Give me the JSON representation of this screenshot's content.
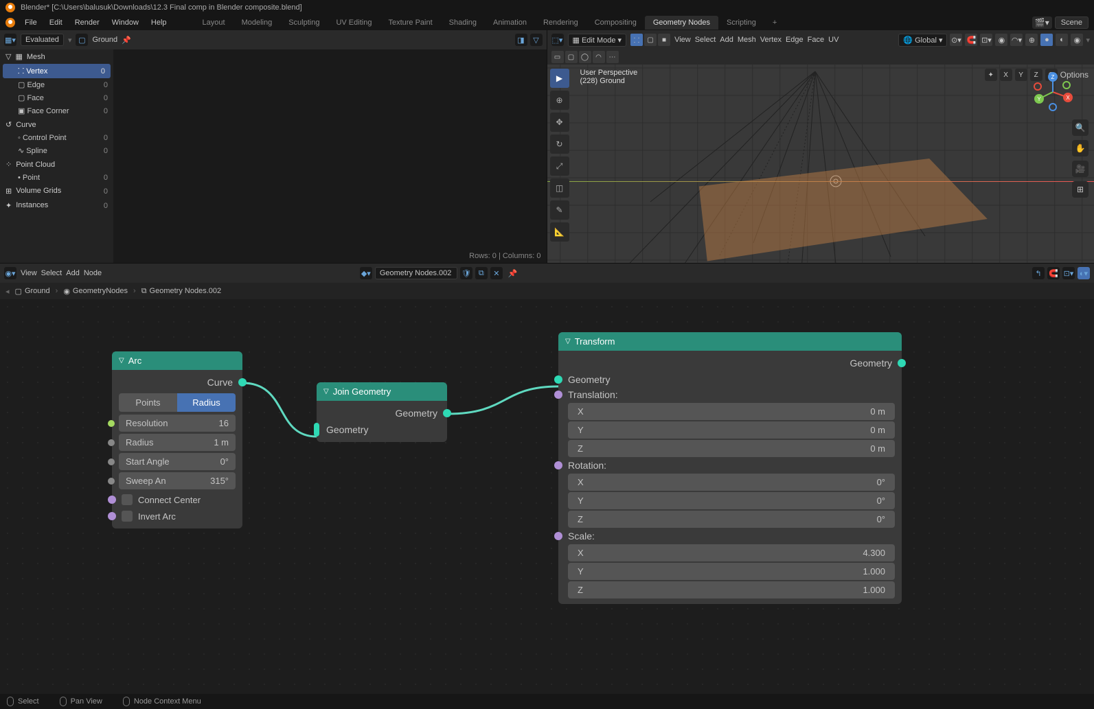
{
  "titlebar": {
    "text": "Blender* [C:\\Users\\balusuk\\Downloads\\12.3 Final comp in Blender composite.blend]"
  },
  "topmenu": {
    "items": [
      "File",
      "Edit",
      "Render",
      "Window",
      "Help"
    ]
  },
  "workspaces": {
    "tabs": [
      "Layout",
      "Modeling",
      "Sculpting",
      "UV Editing",
      "Texture Paint",
      "Shading",
      "Animation",
      "Rendering",
      "Compositing",
      "Geometry Nodes",
      "Scripting"
    ],
    "active": "Geometry Nodes",
    "add": "+"
  },
  "scene": {
    "label": "Scene"
  },
  "spreadsheet": {
    "eval": "Evaluated",
    "object": "Ground",
    "domains": {
      "mesh_label": "Mesh",
      "items_mesh": [
        {
          "label": "Vertex",
          "count": "0",
          "active": true
        },
        {
          "label": "Edge",
          "count": "0"
        },
        {
          "label": "Face",
          "count": "0"
        },
        {
          "label": "Face Corner",
          "count": "0"
        }
      ],
      "curve_label": "Curve",
      "items_curve": [
        {
          "label": "Control Point",
          "count": "0"
        },
        {
          "label": "Spline",
          "count": "0"
        }
      ],
      "pc_label": "Point Cloud",
      "items_pc": [
        {
          "label": "Point",
          "count": "0"
        }
      ],
      "vg_label": "Volume Grids",
      "vg_count": "0",
      "inst_label": "Instances",
      "inst_count": "0"
    },
    "footer": "Rows: 0   |   Columns: 0"
  },
  "viewport": {
    "mode": "Edit Mode",
    "menus": [
      "View",
      "Select",
      "Add",
      "Mesh",
      "Vertex",
      "Edge",
      "Face",
      "UV"
    ],
    "orientation": "Global",
    "options": "Options",
    "info_line1": "User Perspective",
    "info_line2": "(228) Ground",
    "axes": [
      "X",
      "Y",
      "Z"
    ]
  },
  "nodeeditor": {
    "menus": [
      "View",
      "Select",
      "Add",
      "Node"
    ],
    "ng_name": "Geometry Nodes.002",
    "breadcrumb": [
      "Ground",
      "GeometryNodes",
      "Geometry Nodes.002"
    ],
    "nodes": {
      "arc": {
        "title": "Arc",
        "out": "Curve",
        "mode_opts": [
          "Points",
          "Radius"
        ],
        "mode_active": "Radius",
        "fields": [
          {
            "label": "Resolution",
            "value": "16",
            "sock": "lime"
          },
          {
            "label": "Radius",
            "value": "1 m",
            "sock": "gray"
          },
          {
            "label": "Start Angle",
            "value": "0°",
            "sock": "gray"
          },
          {
            "label": "Sweep An",
            "value": "315°",
            "sock": "gray"
          }
        ],
        "checks": [
          {
            "label": "Connect Center",
            "sock": "purple"
          },
          {
            "label": "Invert Arc",
            "sock": "purple"
          }
        ]
      },
      "join": {
        "title": "Join Geometry",
        "out": "Geometry",
        "in": "Geometry"
      },
      "transform": {
        "title": "Transform",
        "out": "Geometry",
        "in": "Geometry",
        "vectors": [
          {
            "label": "Translation:",
            "sock": "purple",
            "rows": [
              [
                "X",
                "0 m"
              ],
              [
                "Y",
                "0 m"
              ],
              [
                "Z",
                "0 m"
              ]
            ]
          },
          {
            "label": "Rotation:",
            "sock": "purple",
            "rows": [
              [
                "X",
                "0°"
              ],
              [
                "Y",
                "0°"
              ],
              [
                "Z",
                "0°"
              ]
            ]
          },
          {
            "label": "Scale:",
            "sock": "purple",
            "rows": [
              [
                "X",
                "4.300"
              ],
              [
                "Y",
                "1.000"
              ],
              [
                "Z",
                "1.000"
              ]
            ]
          }
        ]
      }
    }
  },
  "statusbar": {
    "items": [
      "Select",
      "Pan View",
      "Node Context Menu"
    ]
  }
}
